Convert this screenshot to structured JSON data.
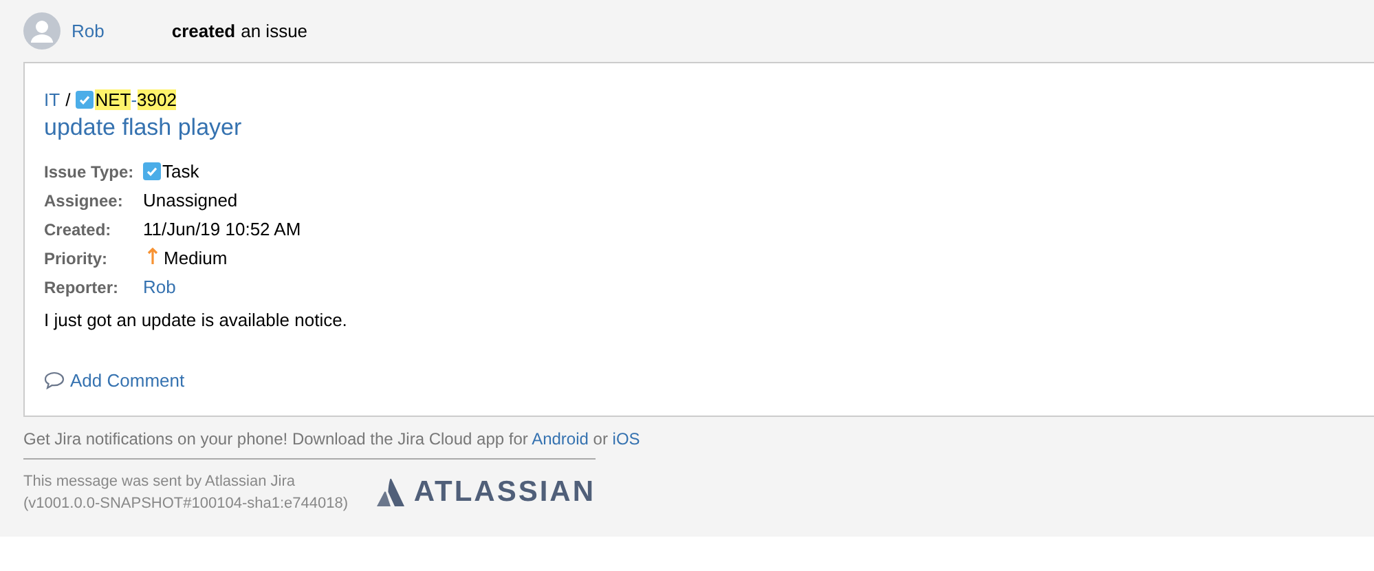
{
  "header": {
    "actor": "Rob",
    "action": "created",
    "suffix": "an issue"
  },
  "issue": {
    "project": "IT",
    "separator": "/",
    "key_parts": [
      {
        "text": "NET",
        "highlighted": true
      },
      {
        "text": "-",
        "highlighted": false
      },
      {
        "text": "3902",
        "highlighted": true
      }
    ],
    "summary": "update flash player",
    "fields": [
      {
        "label": "Issue Type:",
        "value": "Task",
        "kind": "task"
      },
      {
        "label": "Assignee:",
        "value": "Unassigned",
        "kind": "text"
      },
      {
        "label": "Created:",
        "value": "11/Jun/19 10:52 AM",
        "kind": "text"
      },
      {
        "label": "Priority:",
        "value": "Medium",
        "kind": "priority"
      },
      {
        "label": "Reporter:",
        "value": "Rob",
        "kind": "link"
      }
    ],
    "description": "I just got an update is available notice.",
    "add_comment": "Add Comment"
  },
  "footer": {
    "promo": "Get Jira notifications on your phone! Download the Jira Cloud app for",
    "android": "Android",
    "or": "or",
    "ios": "iOS",
    "sent_by": "This message was sent by Atlassian Jira",
    "version": "(v1001.0.0-SNAPSHOT#100104-sha1:e744018)",
    "logo": "ATLASSIAN"
  }
}
